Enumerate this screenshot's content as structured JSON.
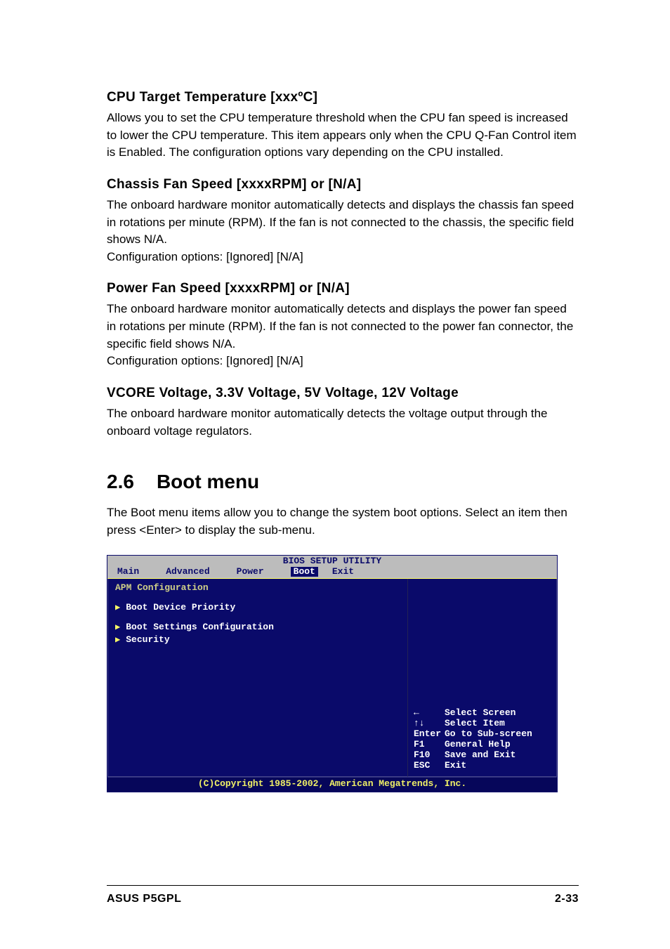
{
  "sections": {
    "cpu": {
      "heading": "CPU Target Temperature [xxxºC]",
      "body": "Allows you to set the CPU temperature threshold when the CPU fan speed is increased to lower the CPU temperature. This item appears only when the CPU Q-Fan Control item is Enabled. The configuration options vary depending on the CPU installed."
    },
    "chassis": {
      "heading": "Chassis Fan Speed [xxxxRPM] or [N/A]",
      "body": "The onboard hardware monitor automatically detects and displays the chassis fan speed in rotations per minute (RPM). If the fan is not connected to the chassis, the specific field shows N/A.",
      "config": "Configuration options: [Ignored] [N/A]"
    },
    "powerfan": {
      "heading": "Power Fan Speed [xxxxRPM] or [N/A]",
      "body": "The onboard hardware monitor automatically detects and displays the power fan speed in rotations per minute (RPM). If the fan is not connected to the power fan connector, the specific field shows N/A.",
      "config": "Configuration options: [Ignored] [N/A]"
    },
    "vcore": {
      "heading": "VCORE Voltage, 3.3V Voltage, 5V Voltage, 12V Voltage",
      "body": "The onboard hardware monitor automatically detects the voltage output through the onboard voltage regulators."
    }
  },
  "boot_menu": {
    "number": "2.6",
    "title": "Boot menu",
    "intro": "The Boot menu items allow you to change the system boot options. Select an item then press <Enter> to display the sub-menu."
  },
  "bios": {
    "title": "BIOS SETUP UTILITY",
    "tabs": [
      "Main",
      "Advanced",
      "Power",
      "Boot",
      "Exit"
    ],
    "active_tab": "Boot",
    "left_heading": "APM Configuration",
    "items": [
      "Boot Device Priority",
      "Boot Settings Configuration",
      "Security"
    ],
    "help": [
      {
        "key": "←",
        "label": "Select Screen"
      },
      {
        "key": "↑↓",
        "label": "Select Item"
      },
      {
        "key": "Enter",
        "label": "Go to Sub-screen"
      },
      {
        "key": "F1",
        "label": "General Help"
      },
      {
        "key": "F10",
        "label": "Save and Exit"
      },
      {
        "key": "ESC",
        "label": "Exit"
      }
    ],
    "copyright": "(C)Copyright 1985-2002, American Megatrends, Inc."
  },
  "footer": {
    "left": "ASUS P5GPL",
    "right": "2-33"
  }
}
